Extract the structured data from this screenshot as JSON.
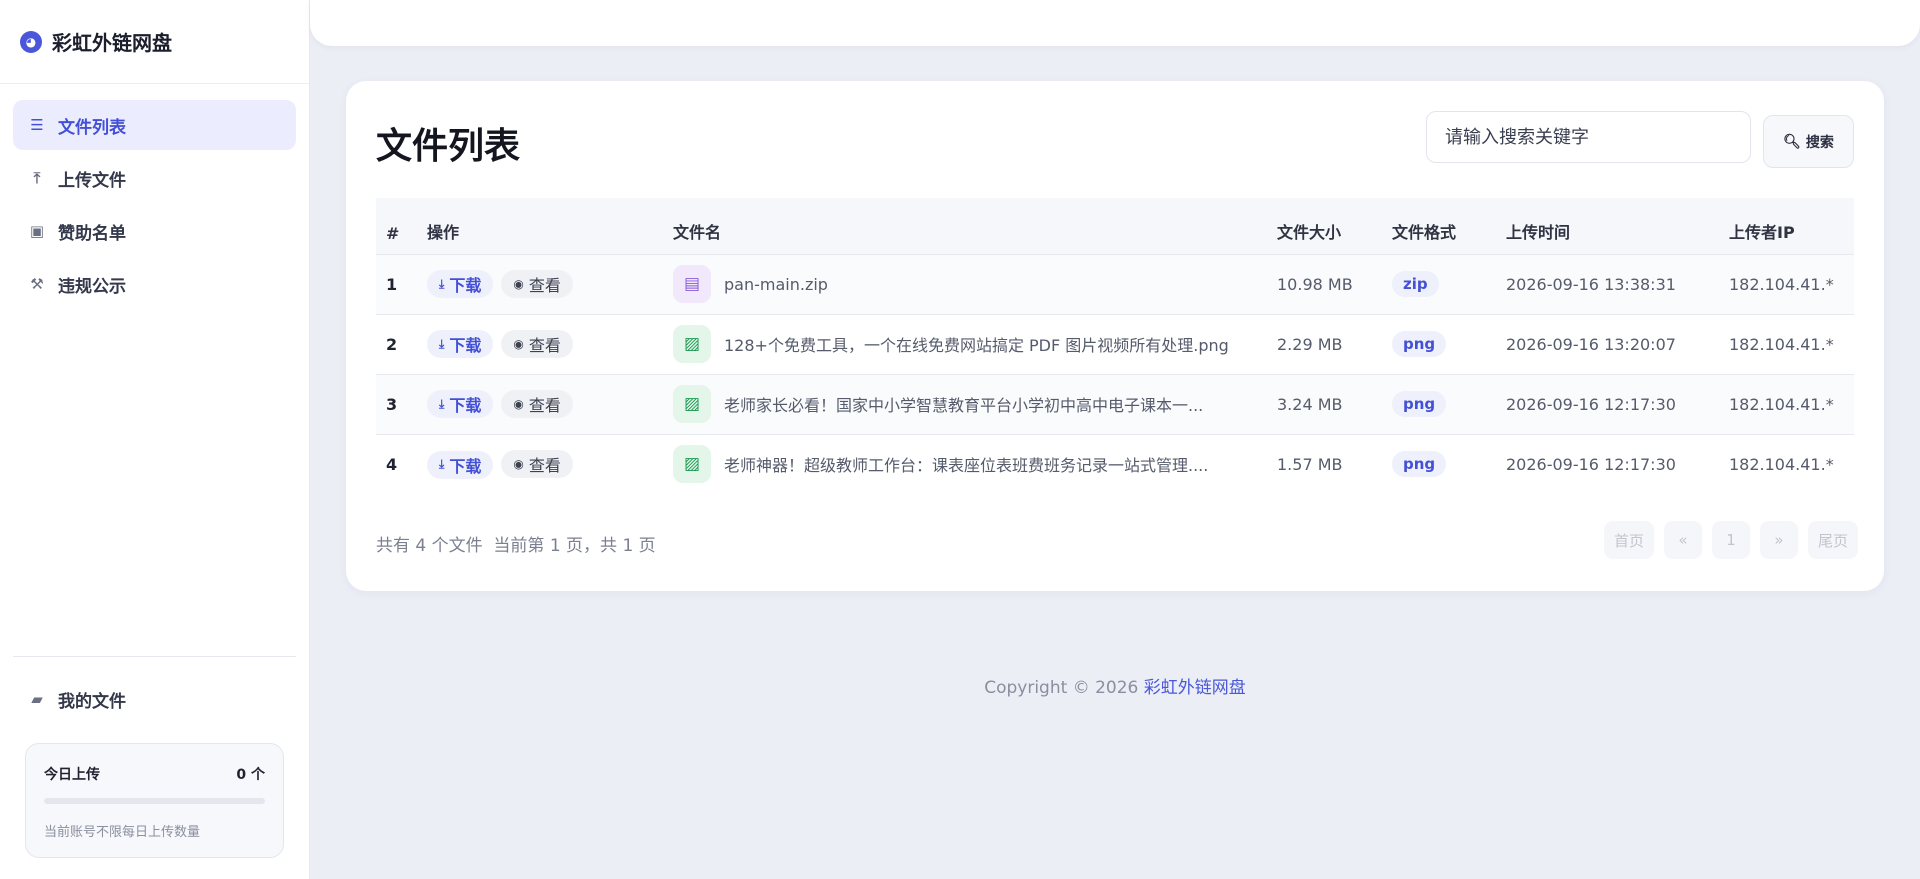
{
  "sidebar": {
    "brand": "彩虹外链网盘",
    "brand_icon": "gauge-icon",
    "items": [
      {
        "label": "文件列表",
        "icon": "list-icon",
        "active": true
      },
      {
        "label": "上传文件",
        "icon": "upload-icon",
        "active": false
      },
      {
        "label": "赞助名单",
        "icon": "money-icon",
        "active": false
      },
      {
        "label": "违规公示",
        "icon": "gavel-icon",
        "active": false
      }
    ],
    "my_files": {
      "label": "我的文件",
      "icon": "folder-open-icon"
    },
    "upload_card": {
      "title": "今日上传",
      "count": "0 个",
      "progress": 0,
      "note": "当前账号不限每日上传数量"
    }
  },
  "main": {
    "title": "文件列表",
    "search": {
      "placeholder": "请输入搜索关键字",
      "button": "搜索"
    },
    "table": {
      "headers": [
        "#",
        "操作",
        "文件名",
        "文件大小",
        "文件格式",
        "上传时间",
        "上传者IP"
      ],
      "download_label": "下载",
      "view_label": "查看",
      "rows": [
        {
          "num": "1",
          "name": "pan-main.zip",
          "type": "zip",
          "size": "10.98 MB",
          "format": "zip",
          "time": "2026-09-16 13:38:31",
          "ip": "182.104.41.*"
        },
        {
          "num": "2",
          "name": "128+个免费工具，一个在线免费网站搞定 PDF 图片视频所有处理.png",
          "type": "png",
          "size": "2.29 MB",
          "format": "png",
          "time": "2026-09-16 13:20:07",
          "ip": "182.104.41.*"
        },
        {
          "num": "3",
          "name": "老师家长必看！国家中小学智慧教育平台小学初中高中电子课本一...",
          "type": "png",
          "size": "3.24 MB",
          "format": "png",
          "time": "2026-09-16 12:17:30",
          "ip": "182.104.41.*"
        },
        {
          "num": "4",
          "name": "老师神器！超级教师工作台：课表座位表班费班务记录一站式管理....",
          "type": "png",
          "size": "1.57 MB",
          "format": "png",
          "time": "2026-09-16 12:17:30",
          "ip": "182.104.41.*"
        }
      ]
    },
    "pagination": {
      "info": "共有 4 个文件  当前第 1 页，共 1 页",
      "first": "首页",
      "prev": "«",
      "current": "1",
      "next": "»",
      "last": "尾页"
    }
  },
  "footer": {
    "text": "Copyright © 2026 ",
    "brand": "彩虹外链网盘"
  },
  "colors": {
    "accent": "#4a57d8",
    "active_bg": "#ebedfe",
    "png_icon": "#1c9a52",
    "zip_icon": "#8b5bd6"
  }
}
